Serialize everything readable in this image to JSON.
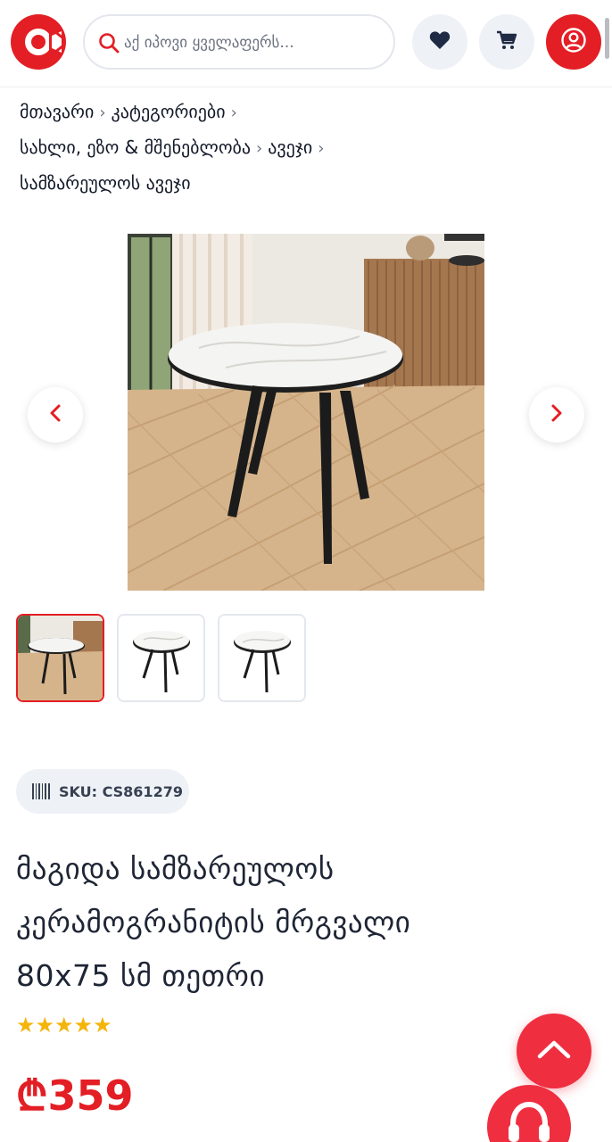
{
  "header": {
    "search_placeholder": "აქ იპოვი ყველაფერს...",
    "logo_icon": "brand-logo-icon",
    "favorites_icon": "heart-icon",
    "cart_icon": "cart-icon",
    "profile_icon": "user-icon",
    "brand_color": "#e31e24"
  },
  "breadcrumb": {
    "items": [
      "მთავარი",
      "კატეგორიები",
      "სახლი, ეზო & მშენებლობა",
      "ავეჯი",
      "სამზარეულოს ავეჯი"
    ],
    "separator": "›"
  },
  "gallery": {
    "prev_icon": "chevron-left-icon",
    "next_icon": "chevron-right-icon",
    "thumbnail_count": 3,
    "active_thumbnail": 1
  },
  "product": {
    "sku_label": "SKU: CS861279",
    "title_lines": [
      "მაგიდა სამზარეულოს",
      "კერამოგრანიტის მრგვალი",
      "80x75 სმ თეთრი"
    ],
    "rating": 5,
    "rating_max": 5,
    "stars": "★★★★★",
    "price": "₾359"
  },
  "floating": {
    "scroll_top_icon": "chevron-up-icon",
    "support_icon": "headset-icon",
    "accent": "#ef2e40"
  }
}
